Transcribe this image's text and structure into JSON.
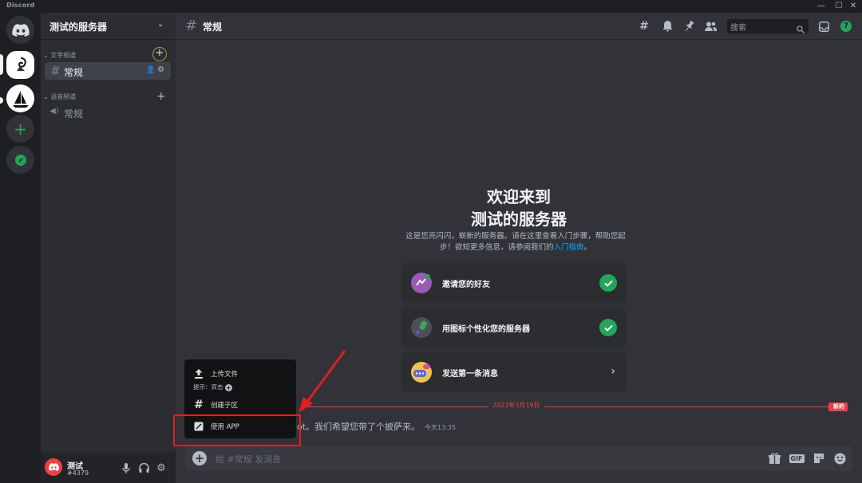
{
  "window": {
    "app_name": "Discord",
    "minimize": "—",
    "maximize": "☐",
    "close": "✕"
  },
  "guilds": {
    "items": [
      {
        "name": "discord-home",
        "color": "#5865f2"
      },
      {
        "name": "server-test",
        "color": "#ffffff"
      },
      {
        "name": "server-sailboat",
        "color": "#ffffff"
      },
      {
        "name": "add-server",
        "color": "#23a55a"
      },
      {
        "name": "explore",
        "color": "#23a55a"
      }
    ]
  },
  "sidebar": {
    "server_name": "测试的服务器",
    "text_category": "文字频道",
    "voice_category": "语音频道",
    "text_channel": "常规",
    "voice_channel": "常规"
  },
  "user": {
    "name": "测试",
    "tag": "#4379"
  },
  "header": {
    "channel": "常规",
    "search_placeholder": "搜索"
  },
  "welcome": {
    "line1": "欢迎来到",
    "line2": "测试的服务器",
    "desc_part1": "这是您亮闪闪，崭新的服务器。请在这里查看入门步骤，帮助您起步！欲知更多信息，请参阅我们的",
    "desc_link": "入门指南",
    "desc_end": "。",
    "cards": [
      {
        "label": "邀请您的好友",
        "done": true
      },
      {
        "label": "用图标个性化您的服务器",
        "done": true
      },
      {
        "label": "发送第一条消息",
        "done": false
      }
    ]
  },
  "divider": {
    "date": "2023年3月19日",
    "new_label": "新的"
  },
  "system_message": {
    "text": "ot。我们希望您带了个披萨来。",
    "timestamp": "今天13:35"
  },
  "composer": {
    "placeholder": "给 #常规 发消息",
    "gif": "GIF"
  },
  "popup": {
    "upload": "上传文件",
    "hint": "提示：双击",
    "create_thread": "创建子区",
    "use_app": "使用 APP"
  },
  "colors": {
    "accent": "#5865f2",
    "danger": "#f23f43",
    "success": "#23a55a",
    "link": "#00a8fc"
  }
}
